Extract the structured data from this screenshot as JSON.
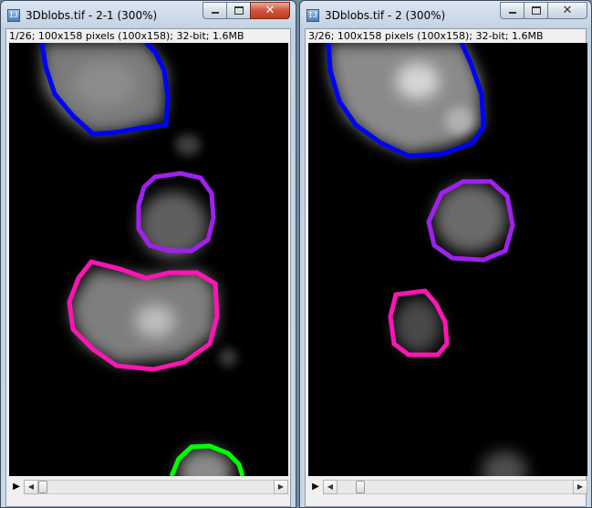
{
  "windows": [
    {
      "title": "3Dblobs.tif - 2-1 (300%)",
      "info": "1/26; 100x158 pixels (100x158); 32-bit; 1.6MB",
      "slider": {
        "slice": 1,
        "total": 26
      },
      "controls": {
        "close": "✕"
      }
    },
    {
      "title": "3Dblobs.tif - 2 (300%)",
      "info": "3/26; 100x158 pixels (100x158); 32-bit; 1.6MB",
      "slider": {
        "slice": 3,
        "total": 26
      },
      "controls": {
        "close": "✕"
      }
    }
  ],
  "icons": {
    "app_glyph": "IJ",
    "play": "▶",
    "scroll_left": "◀",
    "scroll_right": "▶"
  },
  "roi_colors": {
    "blue": "#0000ff",
    "violet": "#a020f0",
    "magenta": "#ff14b4",
    "green": "#00ff00"
  }
}
